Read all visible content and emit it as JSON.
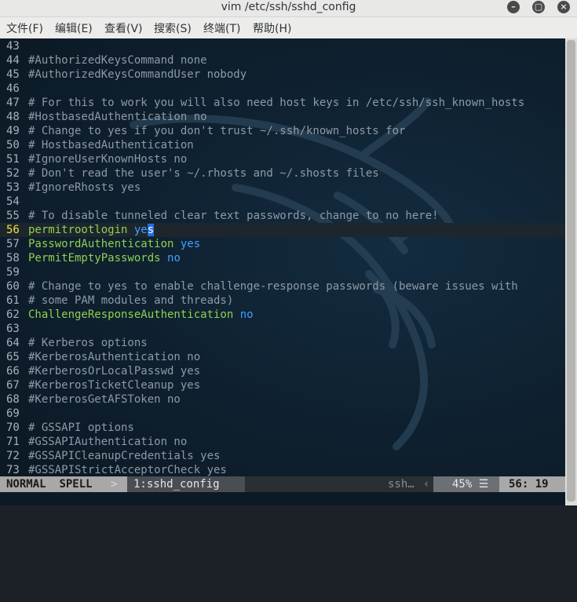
{
  "window": {
    "title": "vim /etc/ssh/sshd_config",
    "minimize_icon": "minimize-icon",
    "maximize_icon": "maximize-icon",
    "close_icon": "close-icon"
  },
  "menu": [
    {
      "label": "文件(F)"
    },
    {
      "label": "编辑(E)"
    },
    {
      "label": "查看(V)"
    },
    {
      "label": "搜索(S)"
    },
    {
      "label": "终端(T)"
    },
    {
      "label": "帮助(H)"
    }
  ],
  "editor": {
    "lines": [
      {
        "n": "43",
        "parts": []
      },
      {
        "n": "44",
        "parts": [
          {
            "t": "#AuthorizedKeysCommand none",
            "c": "c"
          }
        ]
      },
      {
        "n": "45",
        "parts": [
          {
            "t": "#AuthorizedKeysCommandUser nobody",
            "c": "c"
          }
        ]
      },
      {
        "n": "46",
        "parts": []
      },
      {
        "n": "47",
        "parts": [
          {
            "t": "# For this to work you will also need host keys in /etc/ssh/ssh_known_hosts",
            "c": "c"
          }
        ]
      },
      {
        "n": "48",
        "parts": [
          {
            "t": "#HostbasedAuthentication no",
            "c": "c"
          }
        ]
      },
      {
        "n": "49",
        "parts": [
          {
            "t": "# Change to yes if you don't trust ~/.ssh/known_hosts for",
            "c": "c"
          }
        ]
      },
      {
        "n": "50",
        "parts": [
          {
            "t": "# HostbasedAuthentication",
            "c": "c"
          }
        ]
      },
      {
        "n": "51",
        "parts": [
          {
            "t": "#IgnoreUserKnownHosts no",
            "c": "c"
          }
        ]
      },
      {
        "n": "52",
        "parts": [
          {
            "t": "# Don't read the user's ~/.rhosts and ~/.shosts files",
            "c": "c"
          }
        ]
      },
      {
        "n": "53",
        "parts": [
          {
            "t": "#IgnoreRhosts yes",
            "c": "c"
          }
        ]
      },
      {
        "n": "54",
        "parts": []
      },
      {
        "n": "55",
        "parts": [
          {
            "t": "# To disable tunneled clear text passwords, change to no here!",
            "c": "c"
          }
        ]
      },
      {
        "n": "56",
        "current": true,
        "parts": [
          {
            "t": "permitrootlogin",
            "c": "kw"
          },
          {
            "t": " ",
            "c": "c"
          },
          {
            "t": "ye",
            "c": "val"
          },
          {
            "t": "s",
            "c": "cursor"
          }
        ]
      },
      {
        "n": "57",
        "parts": [
          {
            "t": "PasswordAuthentication",
            "c": "kw"
          },
          {
            "t": " ",
            "c": "c"
          },
          {
            "t": "yes",
            "c": "val"
          }
        ]
      },
      {
        "n": "58",
        "parts": [
          {
            "t": "PermitEmptyPasswords",
            "c": "kw"
          },
          {
            "t": " ",
            "c": "c"
          },
          {
            "t": "no",
            "c": "val"
          }
        ]
      },
      {
        "n": "59",
        "parts": []
      },
      {
        "n": "60",
        "parts": [
          {
            "t": "# Change to yes to enable challenge-response passwords (beware issues with",
            "c": "c"
          }
        ]
      },
      {
        "n": "61",
        "parts": [
          {
            "t": "# some PAM modules and threads)",
            "c": "c"
          }
        ]
      },
      {
        "n": "62",
        "parts": [
          {
            "t": "ChallengeResponseAuthentication",
            "c": "kw"
          },
          {
            "t": " ",
            "c": "c"
          },
          {
            "t": "no",
            "c": "val"
          }
        ]
      },
      {
        "n": "63",
        "parts": []
      },
      {
        "n": "64",
        "parts": [
          {
            "t": "# Kerberos options",
            "c": "c"
          }
        ]
      },
      {
        "n": "65",
        "parts": [
          {
            "t": "#KerberosAuthentication no",
            "c": "c"
          }
        ]
      },
      {
        "n": "66",
        "parts": [
          {
            "t": "#KerberosOrLocalPasswd yes",
            "c": "c"
          }
        ]
      },
      {
        "n": "67",
        "parts": [
          {
            "t": "#KerberosTicketCleanup yes",
            "c": "c"
          }
        ]
      },
      {
        "n": "68",
        "parts": [
          {
            "t": "#KerberosGetAFSToken no",
            "c": "c"
          }
        ]
      },
      {
        "n": "69",
        "parts": []
      },
      {
        "n": "70",
        "parts": [
          {
            "t": "# GSSAPI options",
            "c": "c"
          }
        ]
      },
      {
        "n": "71",
        "parts": [
          {
            "t": "#GSSAPIAuthentication no",
            "c": "c"
          }
        ]
      },
      {
        "n": "72",
        "parts": [
          {
            "t": "#GSSAPICleanupCredentials yes",
            "c": "c"
          }
        ]
      },
      {
        "n": "73",
        "parts": [
          {
            "t": "#GSSAPIStrictAcceptorCheck yes",
            "c": "c"
          }
        ]
      }
    ]
  },
  "status": {
    "mode": "NORMAL",
    "spell": "SPELL",
    "sep": ">",
    "filename": "1:sshd_config",
    "filetype": "ssh…",
    "sep2": "‹",
    "percent": "45%",
    "percent_icon": "☰",
    "position": "56: 19"
  },
  "colors": {
    "comment": "#8e9aa6",
    "keyword": "#8fd14f",
    "value": "#3f9fff",
    "current_line_number": "#f0e040"
  }
}
